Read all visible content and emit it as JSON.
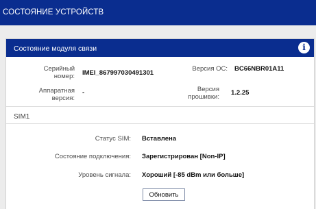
{
  "topbar": {
    "title": "СОСТОЯНИЕ УСТРОЙСТВ"
  },
  "module": {
    "title": "Состояние модуля связи",
    "info_icon": "info-icon",
    "serial_label_1": "Серийный",
    "serial_label_2": "номер:",
    "serial_value": "IMEI_867997030491301",
    "os_label": "Версия ОС:",
    "os_value": "BC66NBR01A11",
    "hw_label_1": "Аппаратная",
    "hw_label_2": "версия:",
    "hw_value": "-",
    "fw_label_1": "Версия",
    "fw_label_2": "прошивки:",
    "fw_value": "1.2.25"
  },
  "sim": {
    "title": "SIM1",
    "status_label": "Статус SIM:",
    "status_value": "Вставлена",
    "connection_label": "Состояние подключения:",
    "connection_value": "Зарегистрирован [Non-IP]",
    "signal_label": "Уровень сигнала:",
    "signal_value": "Хороший [-85 dBm или больше]"
  },
  "buttons": {
    "refresh": "Обновить"
  },
  "colors": {
    "header": "#0a2d8f",
    "background": "#ececec"
  }
}
